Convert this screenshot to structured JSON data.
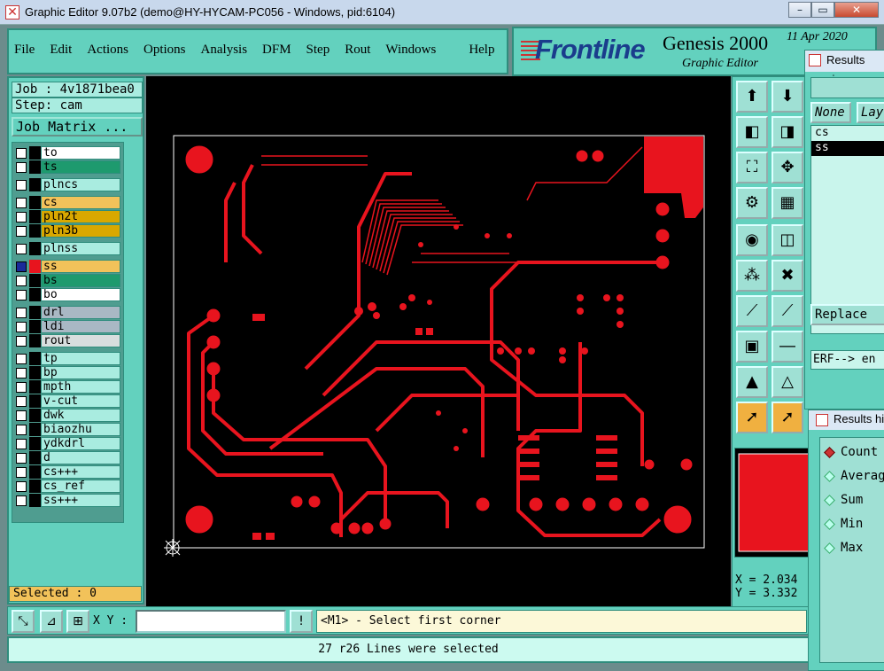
{
  "window": {
    "title": "Graphic Editor 9.07b2 (demo@HY-HYCAM-PC056 - Windows, pid:6104)"
  },
  "menu": [
    "File",
    "Edit",
    "Actions",
    "Options",
    "Analysis",
    "DFM",
    "Step",
    "Rout",
    "Windows",
    "Help"
  ],
  "brand": {
    "logo": "Frontline",
    "product": "Genesis 2000",
    "subtitle": "Graphic Editor",
    "date": "11 Apr 2020"
  },
  "job": {
    "job_label": "Job : 4v1871bea0",
    "step_label": "Step: cam",
    "matrix_button": "Job Matrix ..."
  },
  "layers": [
    {
      "name": "to",
      "bg": "#ffffff"
    },
    {
      "name": "ts",
      "bg": "#1e9a6e"
    },
    {
      "name": "plncs",
      "bg": "#a9ece0"
    },
    {
      "name": "cs",
      "bg": "#f2c25a"
    },
    {
      "name": "pln2t",
      "bg": "#d9a800"
    },
    {
      "name": "pln3b",
      "bg": "#d9a800"
    },
    {
      "name": "plnss",
      "bg": "#a9ece0"
    },
    {
      "name": "ss",
      "bg": "#f2c25a"
    },
    {
      "name": "bs",
      "bg": "#1e9a6e"
    },
    {
      "name": "bo",
      "bg": "#ffffff"
    },
    {
      "name": "drl",
      "bg": "#a9b8c4"
    },
    {
      "name": "ldi",
      "bg": "#a9b8c4"
    },
    {
      "name": "rout",
      "bg": "#d8dede"
    },
    {
      "name": "tp",
      "bg": "#a9ece0"
    },
    {
      "name": "bp",
      "bg": "#a9ece0"
    },
    {
      "name": "mpth",
      "bg": "#a9ece0"
    },
    {
      "name": "v-cut",
      "bg": "#a9ece0"
    },
    {
      "name": "dwk",
      "bg": "#a9ece0"
    },
    {
      "name": "biaozhu",
      "bg": "#a9ece0"
    },
    {
      "name": "ydkdrl",
      "bg": "#a9ece0"
    },
    {
      "name": "d",
      "bg": "#a9ece0"
    },
    {
      "name": "cs+++",
      "bg": "#a9ece0"
    },
    {
      "name": "cs_ref",
      "bg": "#a9ece0"
    },
    {
      "name": "ss+++",
      "bg": "#a9ece0"
    }
  ],
  "selected_label": "Selected : 0",
  "coords": {
    "x": "X = 2.034",
    "y": "Y = 3.332"
  },
  "xy_label": "X Y :",
  "xy_value": "",
  "prompt": "<M1> - Select first corner",
  "status": "27 r26 Lines were selected",
  "results_viewer": {
    "title": "Results view",
    "none_btn": "None",
    "lay_btn": "Lay",
    "items": [
      "cs",
      "ss"
    ],
    "replace_btn": "Replace",
    "erf_text": "ERF--> en"
  },
  "results_hist": {
    "title": "Results hi",
    "options": [
      "Count",
      "Averag",
      "Sum",
      "Min",
      "Max"
    ]
  },
  "colors": {
    "trace": "#e8141e",
    "panel": "#63d1be"
  }
}
